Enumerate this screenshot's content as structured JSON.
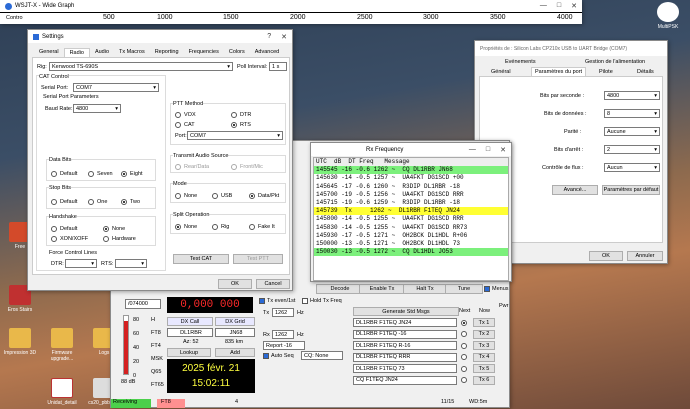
{
  "wsjt": {
    "title": "WSJT-X - Wide Graph",
    "graph_label": "Contro",
    "scale": [
      "500",
      "1000",
      "1500",
      "2000",
      "2500",
      "3000",
      "3500",
      "4000"
    ]
  },
  "settings": {
    "title": "Settings",
    "tabs": [
      "General",
      "Radio",
      "Audio",
      "Tx Macros",
      "Reporting",
      "Frequencies",
      "Colors",
      "Advanced"
    ],
    "rig_label": "Rig:",
    "rig_value": "Kenwood TS-690S",
    "poll_label": "Poll Interval:",
    "poll_value": "1 s",
    "cat_control": "CAT Control",
    "serial_port_label": "Serial Port:",
    "serial_port_value": "COM7",
    "serial_params": "Serial Port Parameters",
    "baud_label": "Baud Rate:",
    "baud_value": "4800",
    "data_bits": "Data Bits",
    "db_opts": [
      "Default",
      "Seven",
      "Eight"
    ],
    "stop_bits": "Stop Bits",
    "sb_opts": [
      "Default",
      "One",
      "Two"
    ],
    "handshake": "Handshake",
    "hs_opts": [
      "Default",
      "None",
      "XON/XOFF",
      "Hardware"
    ],
    "force_lines": "Force Control Lines",
    "dtr_label": "DTR:",
    "rts_label": "RTS:",
    "ptt_method": "PTT Method",
    "ptt_opts": [
      "VOX",
      "DTR",
      "CAT",
      "RTS"
    ],
    "port_label": "Port:",
    "port_value": "COM7",
    "tx_audio": "Transmit Audio Source",
    "tx_audio_opts": [
      "Rear/Data",
      "Front/Mic"
    ],
    "mode": "Mode",
    "mode_opts": [
      "None",
      "USB",
      "Data/Pkt"
    ],
    "split": "Split Operation",
    "split_opts": [
      "None",
      "Rig",
      "Fake It"
    ],
    "test_cat": "Test CAT",
    "test_ptt": "Test PTT",
    "ok": "OK",
    "cancel": "Cancel"
  },
  "com": {
    "title": "Propriétés de : Silicon Labs CP210x USB to UART Bridge (COM7)",
    "tabs_top": [
      "Evénements",
      "Gestion de l'alimentation"
    ],
    "tabs": [
      "Général",
      "Paramètres du port",
      "Pilote",
      "Détails"
    ],
    "rows": [
      {
        "label": "Bits par seconde :",
        "value": "4800"
      },
      {
        "label": "Bits de données :",
        "value": "8"
      },
      {
        "label": "Parité :",
        "value": "Aucune"
      },
      {
        "label": "Bits d'arrêt :",
        "value": "2"
      },
      {
        "label": "Contrôle de flux :",
        "value": "Aucun"
      }
    ],
    "advanced": "Avancé...",
    "defaults": "Paramètres par défaut",
    "ok": "OK",
    "cancel": "Annuler"
  },
  "rx": {
    "title": "Rx Frequency",
    "header": "UTC  dB  DT Freq   Message",
    "rows": [
      {
        "t": "145545 -16 -0.6 1262 ~  CQ DL1RBR JN68",
        "c": "#7cf07c"
      },
      {
        "t": "145630 -14 -0.5 1257 ~  UA4FKT DG1SCD +00",
        "c": ""
      },
      {
        "t": "145645 -17 -0.6 1260 ~  R3DIP DL1RBR -18",
        "c": ""
      },
      {
        "t": "145700 -19 -0.5 1256 ~  UA4FKT DG1SCD RRR",
        "c": ""
      },
      {
        "t": "145715 -19 -0.6 1259 ~  R3DIP DL1RBR -18",
        "c": ""
      },
      {
        "t": "145739  Tx     1262 ~  DL1RBR F1TEQ JN24",
        "c": "#ffff33"
      },
      {
        "t": "145800 -14 -0.5 1255 ~  UA4FKT DG1SCD RRR",
        "c": ""
      },
      {
        "t": "145830 -14 -0.5 1255 ~  UA4FKT DG1SCD RR73",
        "c": ""
      },
      {
        "t": "145930 -17 -0.5 1271 ~  OH2BCK DL1HDL R+06",
        "c": ""
      },
      {
        "t": "150000 -13 -0.5 1271 ~  OH2BCK DL1HDL 73",
        "c": ""
      },
      {
        "t": "150030 -13 -0.5 1272 ~  CQ DL1HDL JO53",
        "c": "#7cf07c"
      }
    ],
    "menus": "Menus",
    "decode": "Decode",
    "enable_tx": "Enable Tx",
    "halt_tx": "Halt Tx",
    "tune": "Tune"
  },
  "main": {
    "freq": "0,000 000",
    "dial": "/074000",
    "tx_even": "Tx even/1st",
    "hold_tx": "Hold Tx Freq",
    "tx_label": "Tx",
    "tx_hz": "1262",
    "rx_label": "Rx",
    "rx_hz": "1262",
    "hz": "Hz",
    "report": "Report -16",
    "auto_seq": "Auto Seq",
    "cq": "CQ: None",
    "dx_call": "DX Call",
    "dx_grid": "DX Grid",
    "call": "DL1RBR",
    "grid": "JN68",
    "az": "Az: 52",
    "km": "835 km",
    "lookup": "Lookup",
    "add": "Add",
    "date": "2025 févr. 21",
    "time": "15:02:11",
    "modes": [
      "H",
      "FT8",
      "FT4",
      "MSK",
      "Q65",
      "FT65"
    ],
    "db": "88 dB",
    "meter_80": "80",
    "meter_60": "60",
    "meter_40": "40",
    "meter_20": "20",
    "meter_0": "0",
    "gen_std": "Generate Std Msgs",
    "next": "Next",
    "now": "Now",
    "pwr": "Pwr",
    "msgs": [
      "DL1RBR F1TEQ JN24",
      "DL1RBR F1TEQ -16",
      "DL1RBR F1TEQ R-16",
      "DL1RBR F1TEQ RRR",
      "DL1RBR F1TEQ 73",
      "CQ F1TEQ JN24"
    ],
    "txbtns": [
      "Tx 1",
      "Tx 2",
      "Tx 3",
      "Tx 4",
      "Tx 5",
      "Tx 6"
    ],
    "status_receiving": "Receiving",
    "status_mode": "FT8",
    "status_4": "4",
    "status_count": "11/15",
    "status_wd": "WD:5m"
  },
  "desktop": [
    "Free",
    "Eros Stairs",
    "Impression 3D",
    "Firmware upgrade...",
    "Logs",
    "Unidat_detail",
    "cs20_pbb_4..."
  ],
  "desktop_right": "MultiPSK"
}
